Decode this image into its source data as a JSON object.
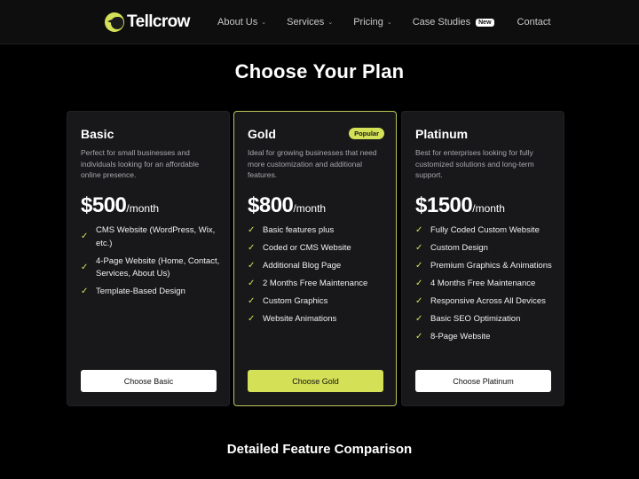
{
  "header": {
    "brand": "Tellcrow",
    "nav": [
      {
        "label": "About Us",
        "has_dropdown": true
      },
      {
        "label": "Services",
        "has_dropdown": true
      },
      {
        "label": "Pricing",
        "has_dropdown": true
      },
      {
        "label": "Case Studies",
        "badge": "New"
      },
      {
        "label": "Contact"
      }
    ],
    "chevron_glyph": "⌄"
  },
  "page": {
    "title": "Choose Your Plan",
    "comparison_title": "Detailed Feature Comparison"
  },
  "colors": {
    "accent": "#d4e157",
    "background": "#000000",
    "card": "#18181b"
  },
  "plans": [
    {
      "name": "Basic",
      "description": "Perfect for small businesses and individuals looking for an affordable online presence.",
      "price": "$500",
      "period": "/month",
      "features": [
        "CMS Website (WordPress, Wix, etc.)",
        "4-Page Website (Home, Contact, Services, About Us)",
        "Template-Based Design"
      ],
      "cta": "Choose Basic"
    },
    {
      "name": "Gold",
      "badge": "Popular",
      "description": "Ideal for growing businesses that need more customization and additional features.",
      "price": "$800",
      "period": "/month",
      "features": [
        "Basic features plus",
        "Coded or CMS Website",
        "Additional Blog Page",
        "2 Months Free Maintenance",
        "Custom Graphics",
        "Website Animations"
      ],
      "cta": "Choose Gold"
    },
    {
      "name": "Platinum",
      "description": "Best for enterprises looking for fully customized solutions and long-term support.",
      "price": "$1500",
      "period": "/month",
      "features": [
        "Fully Coded Custom Website",
        "Custom Design",
        "Premium Graphics & Animations",
        "4 Months Free Maintenance",
        "Responsive Across All Devices",
        "Basic SEO Optimization",
        "8-Page Website"
      ],
      "cta": "Choose Platinum"
    }
  ],
  "check_glyph": "✓"
}
